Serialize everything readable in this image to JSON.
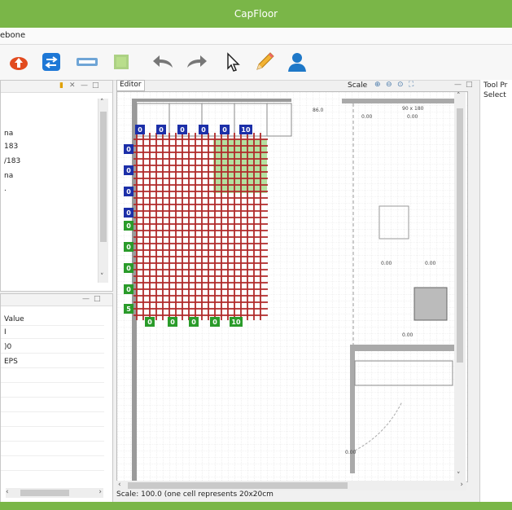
{
  "window": {
    "title": "CapFloor"
  },
  "menu": {
    "label": "ebone"
  },
  "toolbar": {
    "items": [
      {
        "name": "upload-icon",
        "color": "#e24b1f"
      },
      {
        "name": "swap-icon",
        "color": "#1e78d6"
      },
      {
        "name": "wall-icon",
        "color": "#6fa5d6"
      },
      {
        "name": "room-icon",
        "color": "#8cc152"
      },
      {
        "name": "undo-icon",
        "color": "#666666"
      },
      {
        "name": "redo-icon",
        "color": "#666666"
      },
      {
        "name": "select-cursor-icon",
        "color": "#222222"
      },
      {
        "name": "pencil-icon",
        "color": "#f2b233"
      },
      {
        "name": "user-icon",
        "color": "#1e78c8"
      }
    ]
  },
  "left_panel": {
    "items": [
      "na",
      "183",
      "/183",
      "na",
      "."
    ]
  },
  "properties_panel": {
    "header": "Value",
    "rows": [
      "I",
      ")0",
      "EPS"
    ]
  },
  "editor": {
    "tab_label": "Editor",
    "scale_label": "Scale",
    "top_labels": [
      "0.00",
      "0.00"
    ],
    "right_labels": [
      "0.00",
      "0.00",
      "0.00"
    ],
    "room_labels": [
      "90 x 180",
      "86.0"
    ],
    "blue_top": [
      "0",
      "0",
      "0",
      "0",
      "0",
      "10"
    ],
    "blue_left": [
      "0",
      "0",
      "0",
      "0"
    ],
    "green_left": [
      "0",
      "0",
      "0",
      "0",
      "5"
    ],
    "green_bottom": [
      "0",
      "0",
      "0",
      "0",
      "10"
    ],
    "door_label": "0.00"
  },
  "status": {
    "text": "Scale: 100.0 (one cell represents 20x20cm"
  },
  "right_panel": {
    "title": "Tool Pr",
    "subtitle": "Select"
  }
}
